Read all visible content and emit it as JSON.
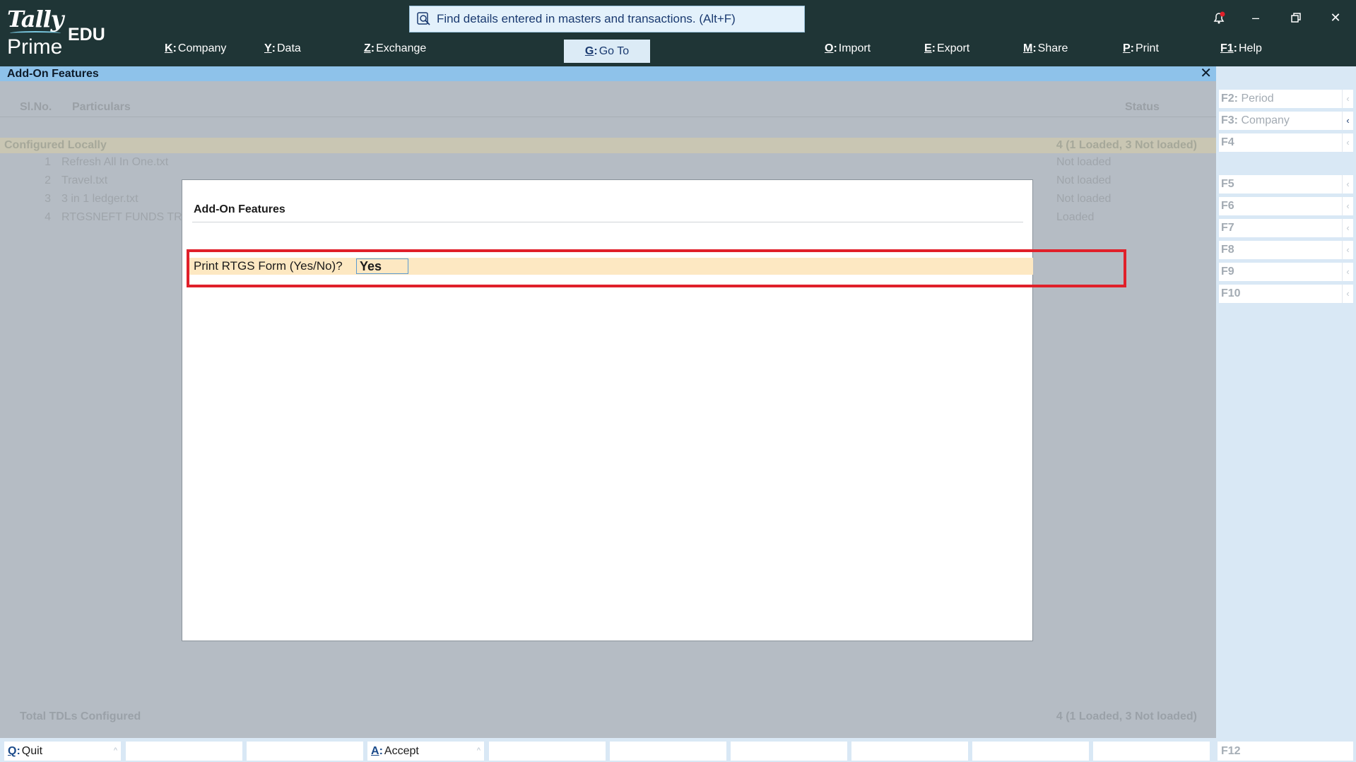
{
  "app": {
    "logo_main": "Tally",
    "logo_sub": "Prime",
    "edition": "EDU"
  },
  "search": {
    "placeholder": "Find details entered in masters and transactions. (Alt+F)"
  },
  "menu": [
    {
      "key": "K",
      "label": "Company"
    },
    {
      "key": "Y",
      "label": "Data"
    },
    {
      "key": "Z",
      "label": "Exchange"
    },
    {
      "key": "G",
      "label": "Go To"
    },
    {
      "key": "O",
      "label": "Import"
    },
    {
      "key": "E",
      "label": "Export"
    },
    {
      "key": "M",
      "label": "Share"
    },
    {
      "key": "P",
      "label": "Print"
    },
    {
      "key": "F1",
      "label": "Help"
    }
  ],
  "window_title": "Add-On Features",
  "report": {
    "columns": {
      "sl": "Sl.No.",
      "particulars": "Particulars",
      "status": "Status"
    },
    "section": {
      "label": "Configured Locally",
      "status": "4 (1 Loaded, 3 Not loaded)"
    },
    "rows": [
      {
        "sl": "1",
        "name": "Refresh All In One.txt",
        "status": "Not loaded"
      },
      {
        "sl": "2",
        "name": "Travel.txt",
        "status": "Not loaded"
      },
      {
        "sl": "3",
        "name": "3 in 1 ledger.txt",
        "status": "Not loaded"
      },
      {
        "sl": "4",
        "name": "RTGSNEFT FUNDS TRA",
        "status": "Loaded"
      }
    ],
    "total": {
      "label": "Total TDLs Configured",
      "status": "4 (1 Loaded, 3 Not loaded)"
    }
  },
  "dialog": {
    "title": "Add-On Features",
    "field_label": "Print RTGS Form (Yes/No)?",
    "field_value": "Yes"
  },
  "side_buttons": [
    {
      "key": "F2",
      "label": "Period"
    },
    {
      "key": "F3",
      "label": "Company"
    },
    {
      "key": "F4",
      "label": ""
    },
    {
      "key": "F5",
      "label": ""
    },
    {
      "key": "F6",
      "label": ""
    },
    {
      "key": "F7",
      "label": ""
    },
    {
      "key": "F8",
      "label": ""
    },
    {
      "key": "F9",
      "label": ""
    },
    {
      "key": "F10",
      "label": ""
    }
  ],
  "bottom_buttons": {
    "quit": {
      "key": "Q",
      "label": "Quit"
    },
    "accept": {
      "key": "A",
      "label": "Accept"
    },
    "f12": "F12"
  },
  "colors": {
    "topbar": "#1f3536",
    "titlebar": "#8ec2ea",
    "highlight": "#e0202a",
    "field_bg": "#fde8c2"
  }
}
